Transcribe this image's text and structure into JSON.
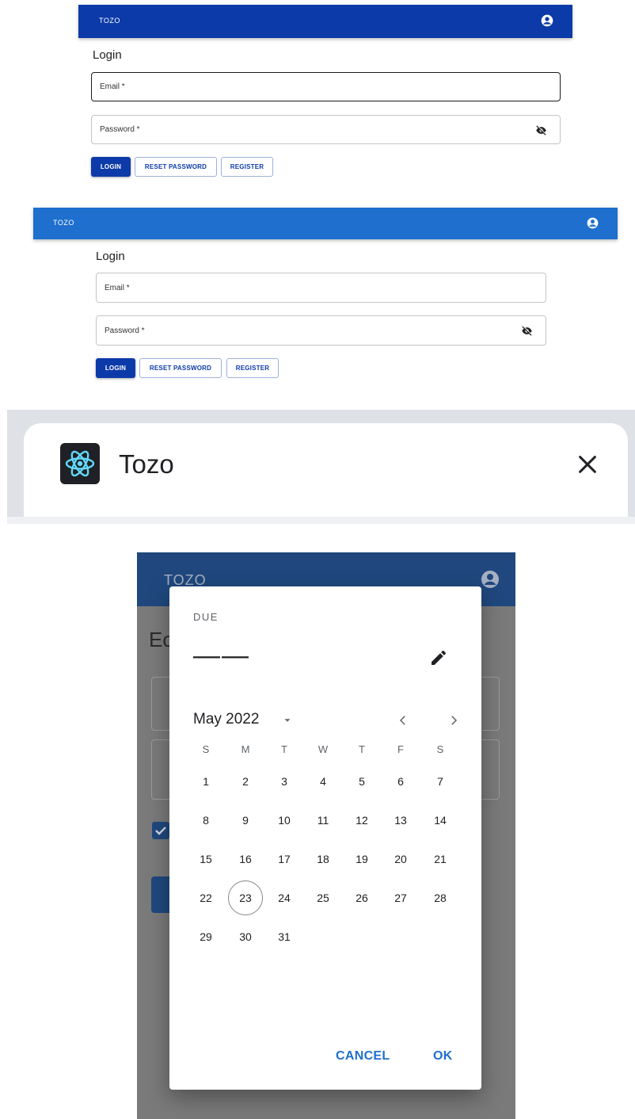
{
  "panel1": {
    "app_bar": {
      "brand": "TOZO",
      "user_icon": "account-circle-icon",
      "color": "#0d3aa9"
    },
    "heading": "Login",
    "email_label": "Email *",
    "password_label": "Password *",
    "visibility_icon": "visibility-off-icon",
    "buttons": {
      "login": "LOGIN",
      "reset": "RESET PASSWORD",
      "register": "REGISTER"
    }
  },
  "panel2": {
    "app_bar": {
      "brand": "TOZO",
      "user_icon": "account-circle-icon",
      "color": "#1e6fce"
    },
    "heading": "Login",
    "email_label": "Email *",
    "password_label": "Password *",
    "visibility_icon": "visibility-off-icon",
    "buttons": {
      "login": "LOGIN",
      "reset": "RESET PASSWORD",
      "register": "REGISTER"
    }
  },
  "panel3": {
    "tab_icon": "react-logo-icon",
    "tab_title": "Tozo",
    "close_icon": "close-icon"
  },
  "panel4": {
    "app_bar": {
      "brand": "TOZO",
      "user_icon": "account-circle-icon",
      "color": "#20487e"
    },
    "background_heading_fragment": "Ec",
    "date_picker": {
      "label": "DUE",
      "value": "——",
      "edit_icon": "pencil-icon",
      "month_label": "May 2022",
      "weekdays": [
        "S",
        "M",
        "T",
        "W",
        "T",
        "F",
        "S"
      ],
      "days": [
        [
          "",
          "1",
          "2",
          "3",
          "4",
          "5",
          "6",
          "7"
        ],
        [
          "8",
          "9",
          "10",
          "11",
          "12",
          "13",
          "14"
        ],
        [
          "15",
          "16",
          "17",
          "18",
          "19",
          "20",
          "21"
        ],
        [
          "22",
          "23",
          "24",
          "25",
          "26",
          "27",
          "28"
        ],
        [
          "29",
          "30",
          "31"
        ]
      ],
      "today": "23",
      "cancel_label": "CANCEL",
      "ok_label": "OK",
      "accent": "#1f6fcd"
    }
  }
}
